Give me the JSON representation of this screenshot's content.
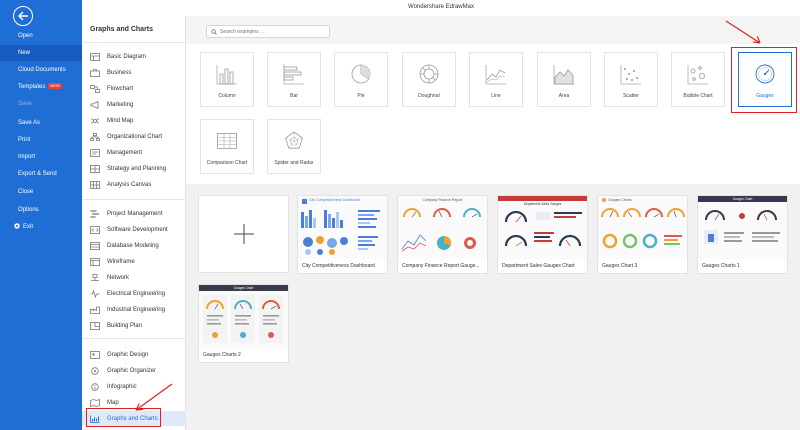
{
  "window": {
    "title": "Wondershare EdrawMax"
  },
  "leftnav": {
    "items": [
      {
        "label": "Open",
        "badge": ""
      },
      {
        "label": "New",
        "badge": ""
      },
      {
        "label": "Cloud Documents",
        "badge": ""
      },
      {
        "label": "Templates",
        "badge": "NEW"
      },
      {
        "label": "Save",
        "badge": ""
      },
      {
        "label": "Save As",
        "badge": ""
      },
      {
        "label": "Print",
        "badge": ""
      },
      {
        "label": "Import",
        "badge": ""
      },
      {
        "label": "Export & Send",
        "badge": ""
      },
      {
        "label": "Close",
        "badge": ""
      },
      {
        "label": "Options",
        "badge": ""
      },
      {
        "label": "Exit",
        "badge": ""
      }
    ]
  },
  "categories": {
    "title": "Graphs and Charts",
    "groups": [
      [
        {
          "label": "Basic Diagram",
          "icon": "basic-diagram-icon"
        },
        {
          "label": "Business",
          "icon": "briefcase-icon"
        },
        {
          "label": "Flowchart",
          "icon": "flowchart-icon"
        },
        {
          "label": "Marketing",
          "icon": "marketing-icon"
        },
        {
          "label": "Mind Map",
          "icon": "mind-map-icon"
        },
        {
          "label": "Organizational Chart",
          "icon": "org-chart-icon"
        },
        {
          "label": "Management",
          "icon": "management-icon"
        },
        {
          "label": "Strategy and Planning",
          "icon": "strategy-icon"
        },
        {
          "label": "Analysis Canvas",
          "icon": "canvas-icon"
        }
      ],
      [
        {
          "label": "Project Management",
          "icon": "gantt-icon"
        },
        {
          "label": "Software Development",
          "icon": "code-icon"
        },
        {
          "label": "Database Modeling",
          "icon": "database-icon"
        },
        {
          "label": "Wireframe",
          "icon": "wireframe-icon"
        },
        {
          "label": "Network",
          "icon": "network-icon"
        },
        {
          "label": "Electrical Engineering",
          "icon": "circuit-icon"
        },
        {
          "label": "Industrial Engineering",
          "icon": "factory-icon"
        },
        {
          "label": "Building Plan",
          "icon": "floor-plan-icon"
        }
      ],
      [
        {
          "label": "Graphic Design",
          "icon": "design-icon"
        },
        {
          "label": "Graphic Organizer",
          "icon": "organizer-icon"
        },
        {
          "label": "Infographic",
          "icon": "infographic-icon"
        },
        {
          "label": "Map",
          "icon": "map-icon"
        },
        {
          "label": "Graphs and Charts",
          "icon": "chart-icon"
        }
      ]
    ]
  },
  "search": {
    "placeholder": "Search examples . . ."
  },
  "chart_types": [
    {
      "label": "Column",
      "icon": "column-chart-icon"
    },
    {
      "label": "Bar",
      "icon": "bar-chart-icon"
    },
    {
      "label": "Pie",
      "icon": "pie-chart-icon"
    },
    {
      "label": "Doughnut",
      "icon": "doughnut-chart-icon"
    },
    {
      "label": "Line",
      "icon": "line-chart-icon"
    },
    {
      "label": "Area",
      "icon": "area-chart-icon"
    },
    {
      "label": "Scatter",
      "icon": "scatter-chart-icon"
    },
    {
      "label": "Bubble Chart",
      "icon": "bubble-chart-icon"
    },
    {
      "label": "Gauges",
      "icon": "gauge-icon"
    },
    {
      "label": "Comparison Chart",
      "icon": "comparison-chart-icon"
    },
    {
      "label": "Spider and Radar",
      "icon": "radar-chart-icon"
    }
  ],
  "templates": [
    {
      "label": "City Competitiveness Dashboard",
      "thumb_title": "City Competitiveness Dashboard"
    },
    {
      "label": "Company Finance Report Gauge...",
      "thumb_title": "Company Finance Report"
    },
    {
      "label": "Department Sales Gauges Chart",
      "thumb_title": "Department Sales Gauges"
    },
    {
      "label": "Gauges Chart 3",
      "thumb_title": "Gauges Charts"
    },
    {
      "label": "Gauges Charts 1",
      "thumb_title": "Gauges Chart"
    },
    {
      "label": "Gauges Charts 2",
      "thumb_title": "Gauges Chart"
    }
  ],
  "colors": {
    "nav_blue": "#1f6ed6",
    "highlight_red": "#e02020",
    "selected_blue": "#1f6ed6"
  }
}
